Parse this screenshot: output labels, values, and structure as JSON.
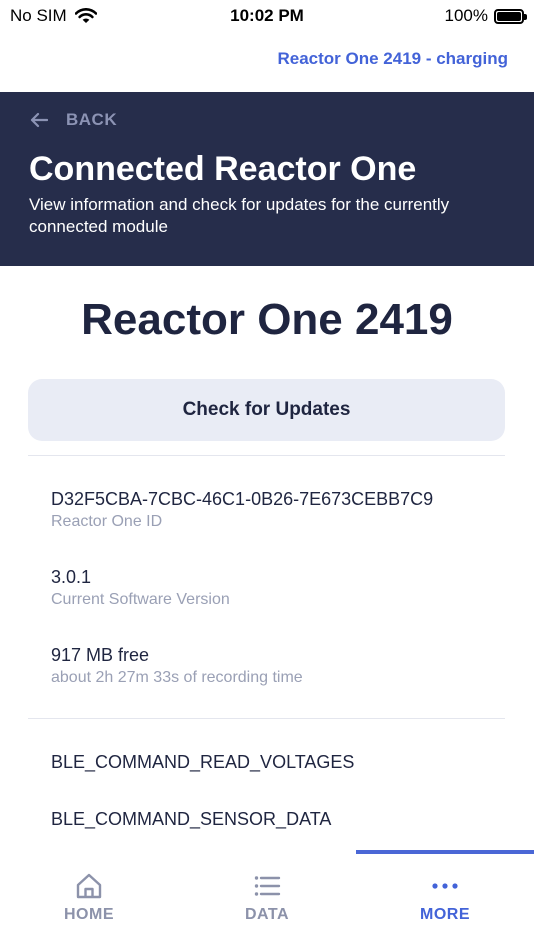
{
  "status_bar": {
    "carrier": "No SIM",
    "time": "10:02 PM",
    "battery": "100%",
    "battery_level": 1.0
  },
  "top_status": "Reactor One 2419 - charging",
  "header": {
    "back_label": "BACK",
    "title": "Connected Reactor One",
    "subtitle": "View information and check for updates for the currently connected module"
  },
  "device_name": "Reactor One 2419",
  "update_button": "Check for Updates",
  "info": [
    {
      "value": "D32F5CBA-7CBC-46C1-0B26-7E673CEBB7C9",
      "label": "Reactor One ID"
    },
    {
      "value": "3.0.1",
      "label": "Current Software Version"
    },
    {
      "value": "917 MB free",
      "label": "about 2h 27m 33s of recording time"
    }
  ],
  "commands": [
    "BLE_COMMAND_READ_VOLTAGES",
    "BLE_COMMAND_SENSOR_DATA"
  ],
  "tabs": [
    {
      "label": "HOME",
      "icon": "home-icon"
    },
    {
      "label": "DATA",
      "icon": "list-icon"
    },
    {
      "label": "MORE",
      "icon": "more-dots-icon"
    }
  ],
  "colors": {
    "header_bg": "#262d4b",
    "accent": "#4363d8",
    "tab_inactive": "#8c92aa"
  }
}
